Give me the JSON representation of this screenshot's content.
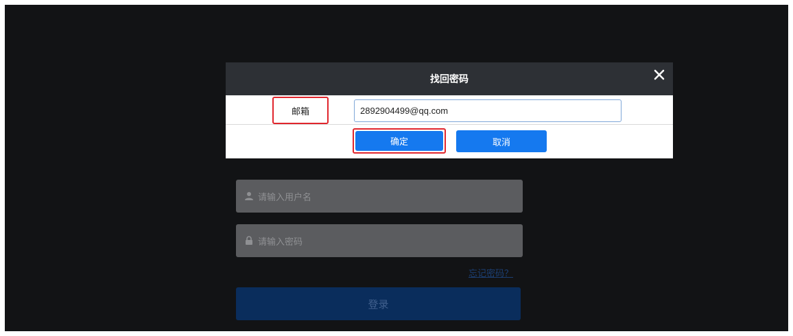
{
  "dialog": {
    "title": "找回密码",
    "close_icon": "close-icon",
    "email_label": "邮箱",
    "email_value": "2892904499@qq.com",
    "confirm_label": "确定",
    "cancel_label": "取消"
  },
  "login": {
    "username_placeholder": "请输入用户名",
    "password_placeholder": "请输入密码",
    "forgot_label": "忘记密码？",
    "login_label": "登录",
    "user_icon": "user-icon",
    "lock_icon": "lock-icon"
  },
  "colors": {
    "background": "#121315",
    "dialog_header": "#2d3035",
    "primary_button": "#1579ef",
    "highlight": "#e0252c"
  }
}
